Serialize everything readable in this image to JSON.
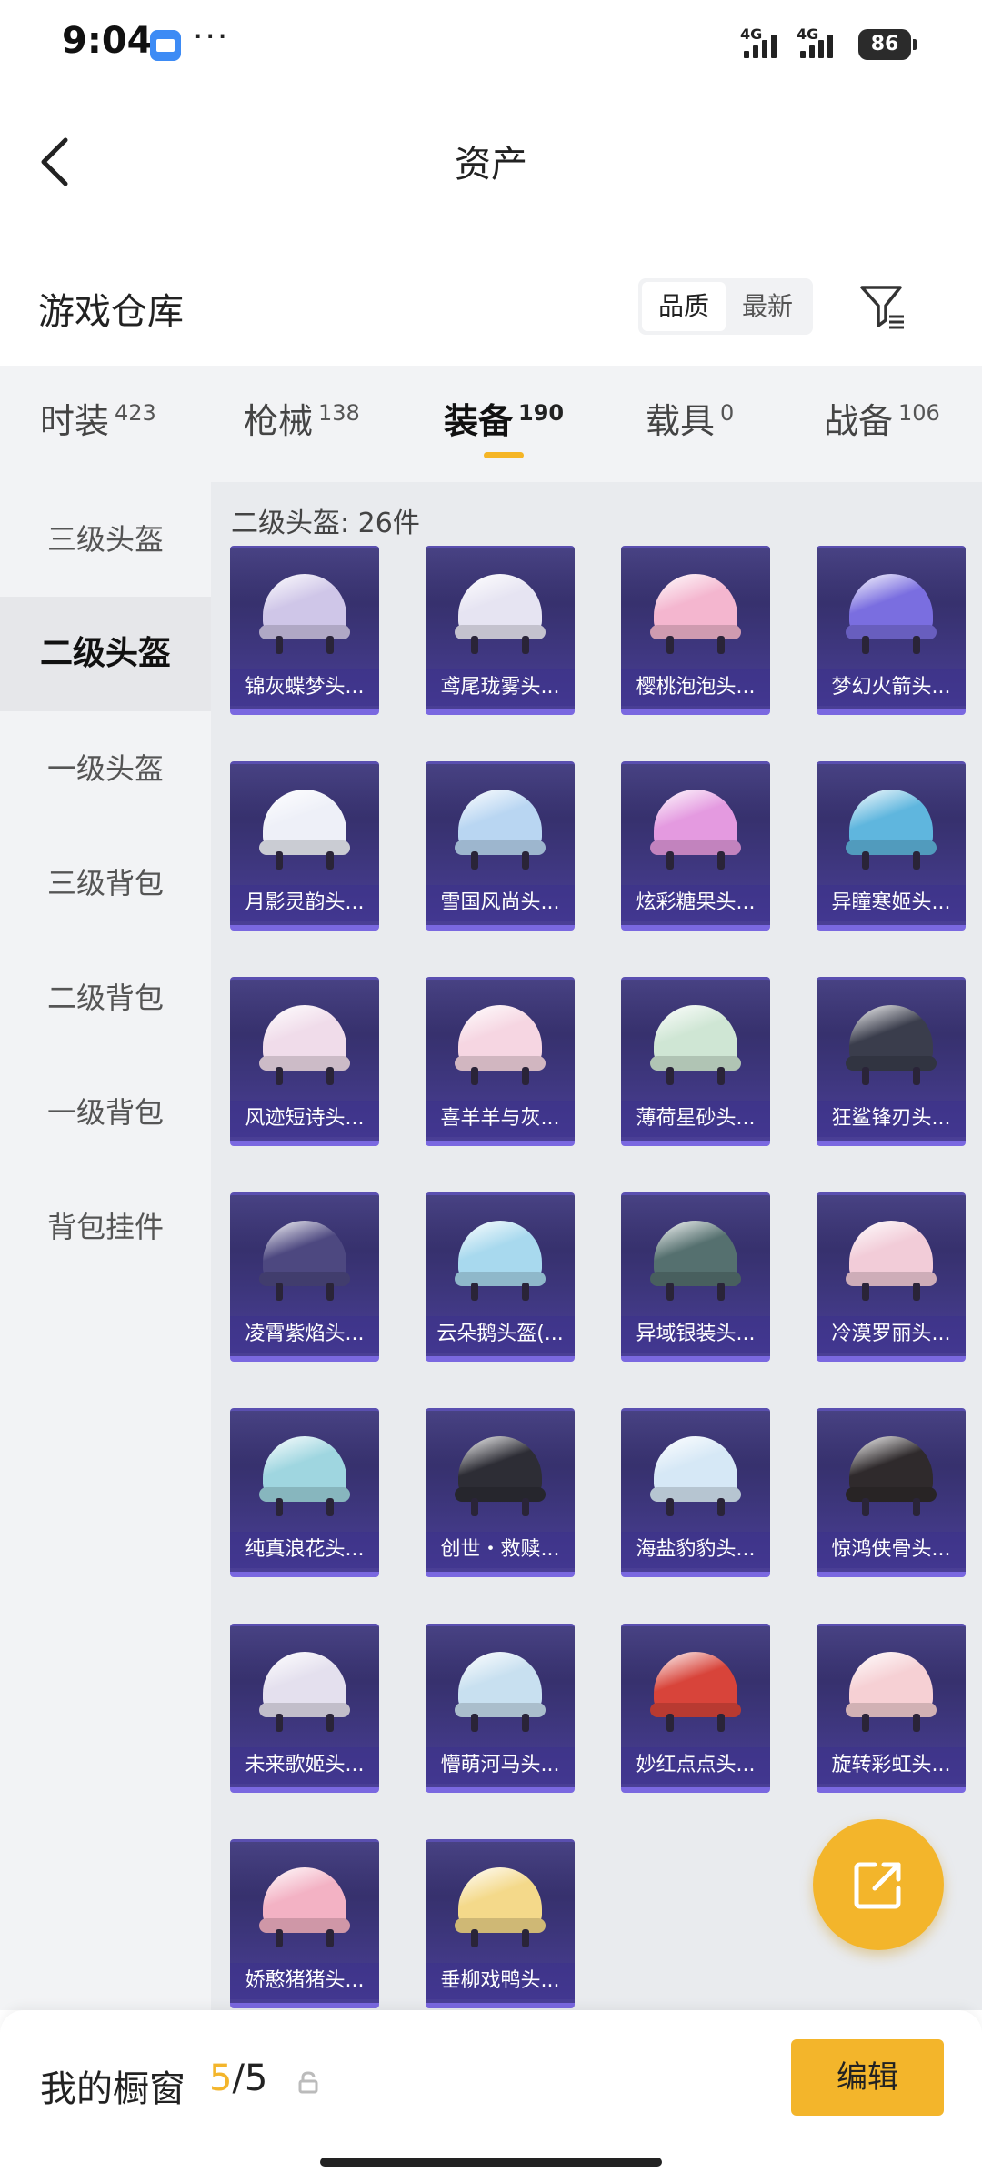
{
  "status": {
    "time": "9:04",
    "dots": "···",
    "net1": "4G",
    "net2": "4G",
    "battery": "86"
  },
  "header": {
    "title": "资产"
  },
  "warehouse": {
    "title": "游戏仓库",
    "sort": [
      "品质",
      "最新"
    ],
    "active_sort": "品质"
  },
  "tabs": [
    {
      "label": "时装",
      "count": "423"
    },
    {
      "label": "枪械",
      "count": "138"
    },
    {
      "label": "装备",
      "count": "190",
      "active": true
    },
    {
      "label": "载具",
      "count": "0"
    },
    {
      "label": "战备",
      "count": "106"
    }
  ],
  "sidebar": [
    "三级头盔",
    "二级头盔",
    "一级头盔",
    "三级背包",
    "二级背包",
    "一级背包",
    "背包挂件"
  ],
  "content": {
    "count_label": "二级头盔: 26件",
    "items": [
      {
        "name": "锦灰蝶梦头...",
        "color": "#cfc6e8"
      },
      {
        "name": "鸢尾珑雾头...",
        "color": "#e6e4f2"
      },
      {
        "name": "樱桃泡泡头...",
        "color": "#f4b6cf"
      },
      {
        "name": "梦幻火箭头...",
        "color": "#7a6ee0"
      },
      {
        "name": "月影灵韵头...",
        "color": "#eef0f8"
      },
      {
        "name": "雪国风尚头...",
        "color": "#b9d6f2"
      },
      {
        "name": "炫彩糖果头...",
        "color": "#e49ae0"
      },
      {
        "name": "异瞳寒姬头...",
        "color": "#5fb6de"
      },
      {
        "name": "风迹短诗头...",
        "color": "#f0dcea"
      },
      {
        "name": "喜羊羊与灰...",
        "color": "#f6d6e2"
      },
      {
        "name": "薄荷星砂头...",
        "color": "#cfe6d4"
      },
      {
        "name": "狂鲨锋刃头...",
        "color": "#3a3d4c"
      },
      {
        "name": "凌霄紫焰头...",
        "color": "#4d4880"
      },
      {
        "name": "云朵鹅头盔(...",
        "color": "#a8d9ee"
      },
      {
        "name": "异域银装头...",
        "color": "#55706f"
      },
      {
        "name": "冷漠罗丽头...",
        "color": "#f2ccd8"
      },
      {
        "name": "纯真浪花头...",
        "color": "#9fd6e0"
      },
      {
        "name": "创世・救赎...",
        "color": "#2d2d35"
      },
      {
        "name": "海盐豹豹头...",
        "color": "#d6e8f6"
      },
      {
        "name": "惊鸿侠骨头...",
        "color": "#2f2a2c"
      },
      {
        "name": "未来歌姬头...",
        "color": "#e4e0ee"
      },
      {
        "name": "懵萌河马头...",
        "color": "#c8e0f0"
      },
      {
        "name": "妙红点点头...",
        "color": "#d8443a"
      },
      {
        "name": "旋转彩虹头...",
        "color": "#f6d0d4"
      },
      {
        "name": "娇憨猪猪头...",
        "color": "#f3b2c4"
      },
      {
        "name": "垂柳戏鸭头...",
        "color": "#f4d98a"
      }
    ]
  },
  "bottom": {
    "label": "我的橱窗",
    "used": "5",
    "total": "/5",
    "edit": "编辑"
  },
  "colors": {
    "accent": "#f3b52b"
  }
}
